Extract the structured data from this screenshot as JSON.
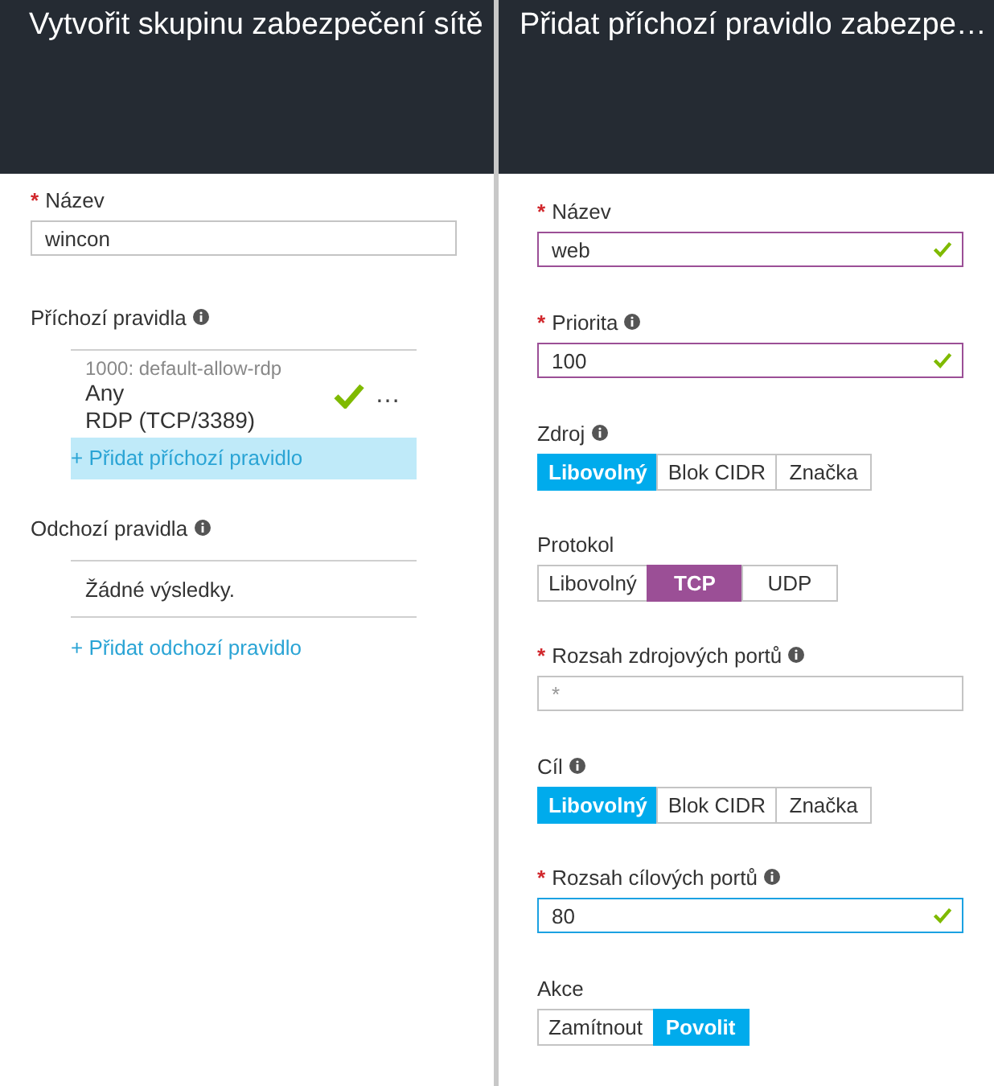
{
  "left_panel": {
    "title": "Vytvořit skupinu zabezpečení sítě",
    "name_field": {
      "label": "Název",
      "required": true,
      "info": false,
      "value": "wincon"
    },
    "inbound": {
      "label": "Příchozí pravidla",
      "info": true,
      "rules": [
        {
          "title": "1000: default-allow-rdp",
          "source": "Any",
          "service": "RDP (TCP/3389)",
          "allowed": true,
          "more": "…"
        }
      ],
      "add_link": {
        "label": "+ Přidat příchozí pravidlo",
        "highlighted": true
      }
    },
    "outbound": {
      "label": "Odchozí pravidla",
      "info": true,
      "empty_text": "Žádné výsledky.",
      "add_link": {
        "label": "+ Přidat odchozí pravidlo",
        "highlighted": false
      }
    }
  },
  "right_panel": {
    "title": "Přidat příchozí pravidlo zabezpe…",
    "fields": [
      {
        "kind": "text",
        "label": "Název",
        "required": true,
        "info": false,
        "value": "web",
        "valid": true,
        "focused": false
      },
      {
        "kind": "text",
        "label": "Priorita",
        "required": true,
        "info": true,
        "value": "100",
        "valid": true,
        "focused": false
      },
      {
        "kind": "choice",
        "label": "Zdroj",
        "required": false,
        "info": true,
        "color": "#00abec",
        "options": [
          {
            "label": "Libovolný",
            "selected": true
          },
          {
            "label": "Blok CIDR",
            "selected": false
          },
          {
            "label": "Značka",
            "selected": false
          }
        ]
      },
      {
        "kind": "choice",
        "label": "Protokol",
        "required": false,
        "info": false,
        "color": "#9b4f96",
        "options": [
          {
            "label": "Libovolný",
            "selected": false
          },
          {
            "label": "TCP",
            "selected": true
          },
          {
            "label": "UDP",
            "selected": false
          }
        ]
      },
      {
        "kind": "text",
        "label": "Rozsah zdrojových portů",
        "required": true,
        "info": true,
        "placeholder": "*",
        "valid": false,
        "focused": false
      },
      {
        "kind": "choice",
        "label": "Cíl",
        "required": false,
        "info": true,
        "color": "#00abec",
        "options": [
          {
            "label": "Libovolný",
            "selected": true
          },
          {
            "label": "Blok CIDR",
            "selected": false
          },
          {
            "label": "Značka",
            "selected": false
          }
        ]
      },
      {
        "kind": "text",
        "label": "Rozsah cílových portů",
        "required": true,
        "info": true,
        "value": "80",
        "valid": true,
        "focused": true
      },
      {
        "kind": "choice",
        "label": "Akce",
        "required": false,
        "info": false,
        "color": "#00abec",
        "options": [
          {
            "label": "Zamítnout",
            "selected": false
          },
          {
            "label": "Povolit",
            "selected": true
          }
        ]
      }
    ]
  }
}
